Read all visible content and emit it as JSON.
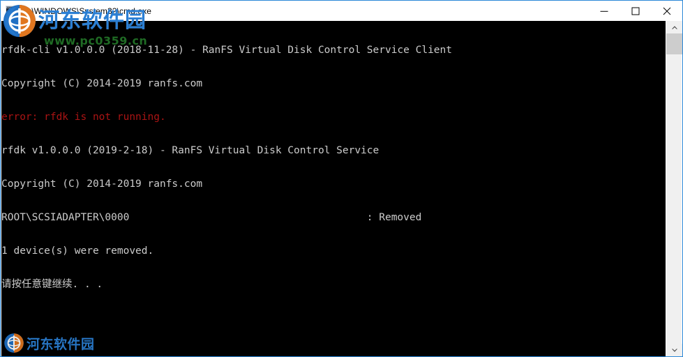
{
  "window": {
    "title": "C:\\WINDOWS\\System32\\cmd.exe",
    "icon": "console-window-icon",
    "border_color": "#2b88d8",
    "background": "#ffffff"
  },
  "window_controls": {
    "minimize_label": "Minimize",
    "maximize_label": "Maximize",
    "close_label": "Close"
  },
  "console": {
    "background": "#000000",
    "foreground": "#cccccc",
    "error_color": "#ab1414",
    "lines": [
      {
        "text": "rfdk-cli v1.0.0.0 (2018-11-28) - RanFS Virtual Disk Control Service Client",
        "color": "white"
      },
      {
        "text": "Copyright (C) 2014-2019 ranfs.com",
        "color": "white"
      },
      {
        "text": "error: rfdk is not running.",
        "color": "red"
      },
      {
        "text": "rfdk v1.0.0.0 (2019-2-18) - RanFS Virtual Disk Control Service",
        "color": "white"
      },
      {
        "text": "Copyright (C) 2014-2019 ranfs.com",
        "color": "white"
      },
      {
        "text": "ROOT\\SCSIADAPTER\\0000                                       : Removed",
        "color": "white"
      },
      {
        "text": "1 device(s) were removed.",
        "color": "white"
      },
      {
        "text": "请按任意键继续. . .",
        "color": "white"
      }
    ]
  },
  "scrollbar": {
    "up_arrow": "chevron-up-icon",
    "down_arrow": "chevron-down-icon",
    "thumb_label": "scroll-thumb"
  },
  "watermark": {
    "site_name": "河东软件园",
    "url": "www.pc0359.cn",
    "brand_color": "#2b7fd4",
    "url_color": "#1f6b24",
    "logo": "circular-globe-logo"
  }
}
